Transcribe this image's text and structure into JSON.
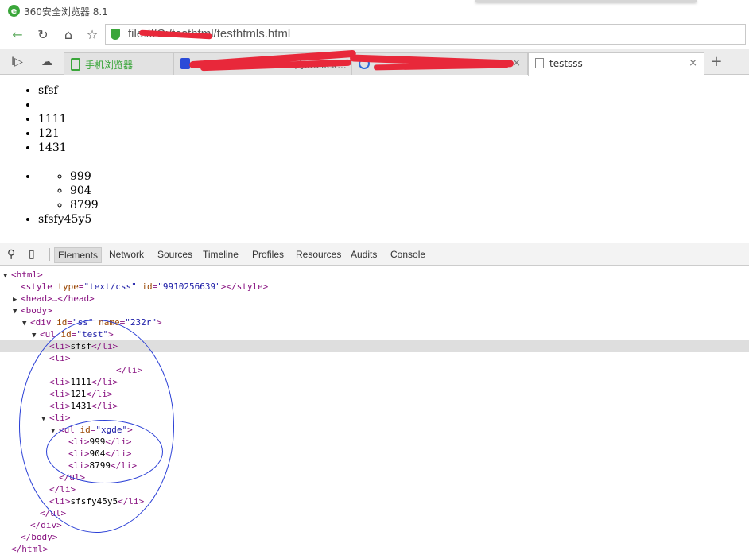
{
  "window": {
    "title": "360安全浏览器 8.1",
    "logo_glyph": "e"
  },
  "address_bar": {
    "url": "file:///C:/testhtml/testhtmls.html"
  },
  "tabs": [
    {
      "label": "手机浏览器",
      "active": false
    },
    {
      "label": "...的onclick...",
      "active": false
    },
    {
      "label": "...",
      "active": false
    },
    {
      "label": "testsss",
      "active": true
    }
  ],
  "new_tab_glyph": "+",
  "close_glyph": "×",
  "page": {
    "list": [
      "sfsf",
      "",
      "1111",
      "121",
      "1431",
      "",
      "sfsfy45y5"
    ],
    "sublist": [
      "999",
      "904",
      "8799"
    ]
  },
  "devtools": {
    "tabs": [
      "Elements",
      "Network",
      "Sources",
      "Timeline",
      "Profiles",
      "Resources",
      "Audits",
      "Console"
    ],
    "active_tab": "Elements"
  },
  "dom_lines": {
    "l0": "<html>",
    "l1_open": "<style ",
    "l1_a1n": "type",
    "l1_a1v": "\"text/css\"",
    "l1_a2n": "id",
    "l1_a2v": "\"9910256639\"",
    "l1_close": "></style>",
    "l2": "<head>…</head>",
    "l3": "<body>",
    "l4_open": "<div ",
    "l4_a1n": "id",
    "l4_a1v": "\"ss\"",
    "l4_a2n": "name",
    "l4_a2v": "\"232r\"",
    "l4_close": ">",
    "l5_open": "<ul ",
    "l5_an": "id",
    "l5_av": "\"test\"",
    "l5_close": ">",
    "l6_t1": "<li>",
    "l6_tx": "sfsf",
    "l6_t2": "</li>",
    "l7": "<li>",
    "l8": "</li>",
    "l9_t1": "<li>",
    "l9_tx": "1111",
    "l9_t2": "</li>",
    "l10_t1": "<li>",
    "l10_tx": "121",
    "l10_t2": "</li>",
    "l11_t1": "<li>",
    "l11_tx": "1431",
    "l11_t2": "</li>",
    "l12": "<li>",
    "l13_open": "<ul ",
    "l13_an": "id",
    "l13_av": "\"xgde\"",
    "l13_close": ">",
    "l14_t1": "<li>",
    "l14_tx": "999",
    "l14_t2": "</li>",
    "l15_t1": "<li>",
    "l15_tx": "904",
    "l15_t2": "</li>",
    "l16_t1": "<li>",
    "l16_tx": "8799",
    "l16_t2": "</li>",
    "l17": "</ul>",
    "l18": "</li>",
    "l19_t1": "<li>",
    "l19_tx": "sfsfy45y5",
    "l19_t2": "</li>",
    "l20": "</ul>",
    "l21": "</div>",
    "l22": "</body>",
    "l23": "</html>"
  },
  "colors": {
    "annotation_ring": "#2a3fd6",
    "redaction": "#e8283a",
    "selected_row": "#dedede"
  }
}
